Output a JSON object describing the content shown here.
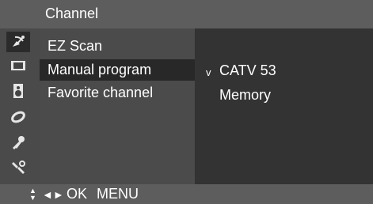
{
  "menu": {
    "title": "Channel",
    "items": [
      {
        "label": "EZ Scan"
      },
      {
        "label": "Manual program"
      },
      {
        "label": "Favorite channel"
      }
    ]
  },
  "submenu": {
    "mark": "v",
    "items": [
      {
        "label": "CATV 53"
      },
      {
        "label": "Memory"
      }
    ]
  },
  "icons": [
    "satellite-dish-icon",
    "screen-icon",
    "speaker-icon",
    "clock-icon",
    "key-icon",
    "tools-icon"
  ],
  "footer": {
    "updown_glyph": "▲▼",
    "leftright_glyph": "◄►",
    "ok_label": "OK",
    "menu_label": "MENU"
  },
  "colors": {
    "title_bar": "#5d5d5d",
    "panel": "#4b4b4b",
    "highlight": "#282828",
    "text": "#ffffff"
  }
}
